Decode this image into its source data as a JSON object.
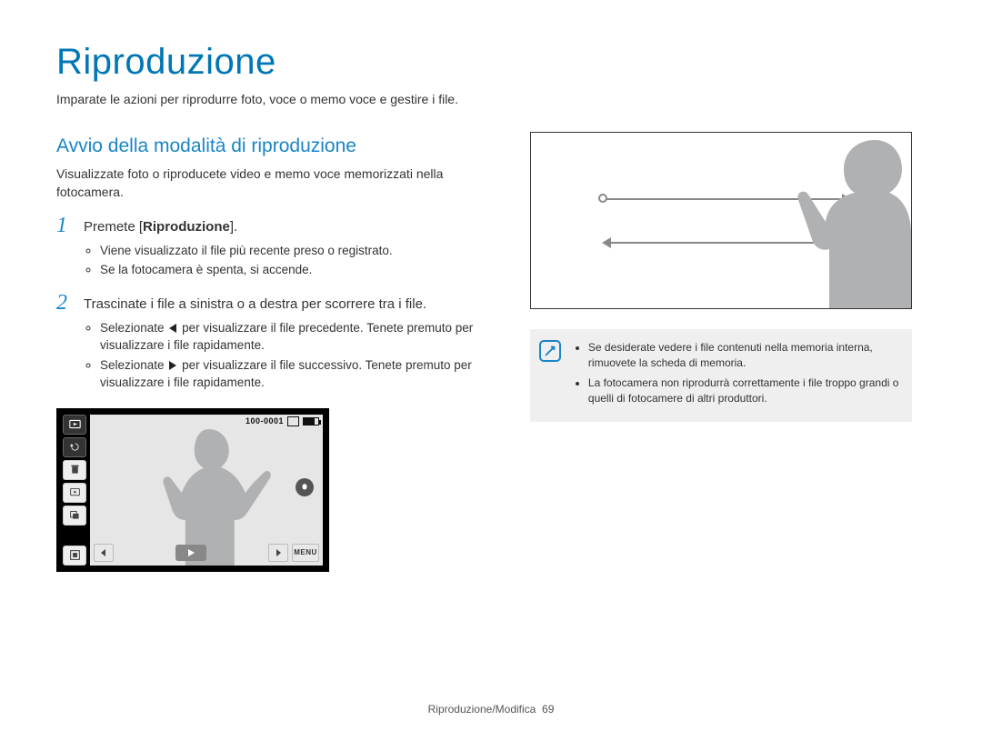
{
  "title": "Riproduzione",
  "intro": "Imparate le azioni per riprodurre foto, voce o memo voce e gestire i file.",
  "section": {
    "heading": "Avvio della modalità di riproduzione",
    "intro": "Visualizzate foto o riproducete video e memo voce memorizzati nella fotocamera."
  },
  "steps": {
    "s1": {
      "num": "1",
      "prefix": "Premete [",
      "bold": "Riproduzione",
      "suffix": "].",
      "bullets": [
        "Viene visualizzato il file più recente preso o registrato.",
        "Se la fotocamera è spenta, si accende."
      ]
    },
    "s2": {
      "num": "2",
      "text": "Trascinate i file a sinistra o a destra per scorrere tra i file.",
      "bullets": {
        "b1": {
          "pre": "Selezionate ",
          "icon": "left",
          "post": " per visualizzare il file precedente. Tenete premuto per visualizzare i file rapidamente."
        },
        "b2": {
          "pre": "Selezionate ",
          "icon": "right",
          "post": " per visualizzare il file successivo. Tenete premuto per visualizzare i file rapidamente."
        }
      }
    }
  },
  "camera": {
    "counter": "100-0001",
    "menu": "MENU"
  },
  "notes": {
    "n1": "Se desiderate vedere i file contenuti nella memoria interna, rimuovete la scheda di memoria.",
    "n2": "La fotocamera non riprodurrà correttamente i file troppo grandi o quelli di fotocamere di altri produttori."
  },
  "footer": {
    "section": "Riproduzione/Modifica",
    "page": "69"
  }
}
